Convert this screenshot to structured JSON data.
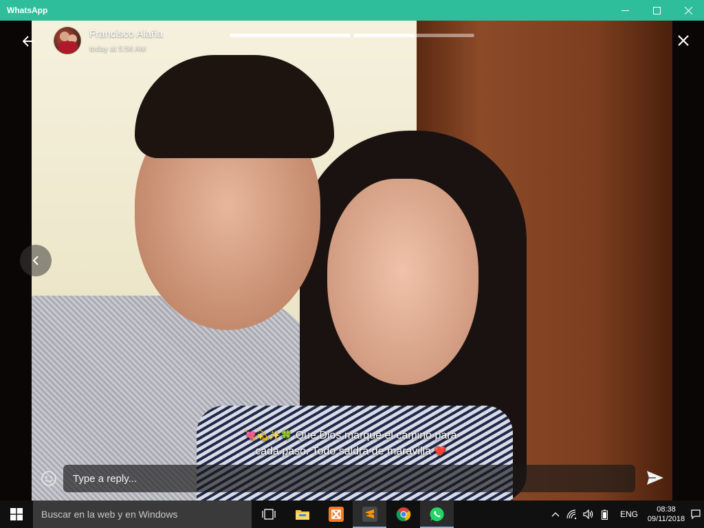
{
  "window": {
    "title": "WhatsApp",
    "titlebar_color": "#2fbe9b"
  },
  "status": {
    "contact_name": "Francisco Alaña",
    "timestamp": "today at 5:56 AM",
    "progress_segments": [
      1.0,
      0.5
    ],
    "caption_emojis": "💘💫✨🍀",
    "caption_line1": " Que Dios marque el camino para",
    "caption_line2": "cada paso. Todo saldrá de maravilla",
    "caption_end_emoji": "❤️"
  },
  "reply": {
    "placeholder": "Type a reply..."
  },
  "taskbar": {
    "search_placeholder": "Buscar en la web y en Windows",
    "apps": [
      "task-view",
      "file-explorer",
      "xampp",
      "sublime-text",
      "chrome",
      "whatsapp"
    ],
    "lang": "ENG",
    "time": "08:38",
    "date": "09/11/2018",
    "whatsapp_color": "#25d366"
  }
}
